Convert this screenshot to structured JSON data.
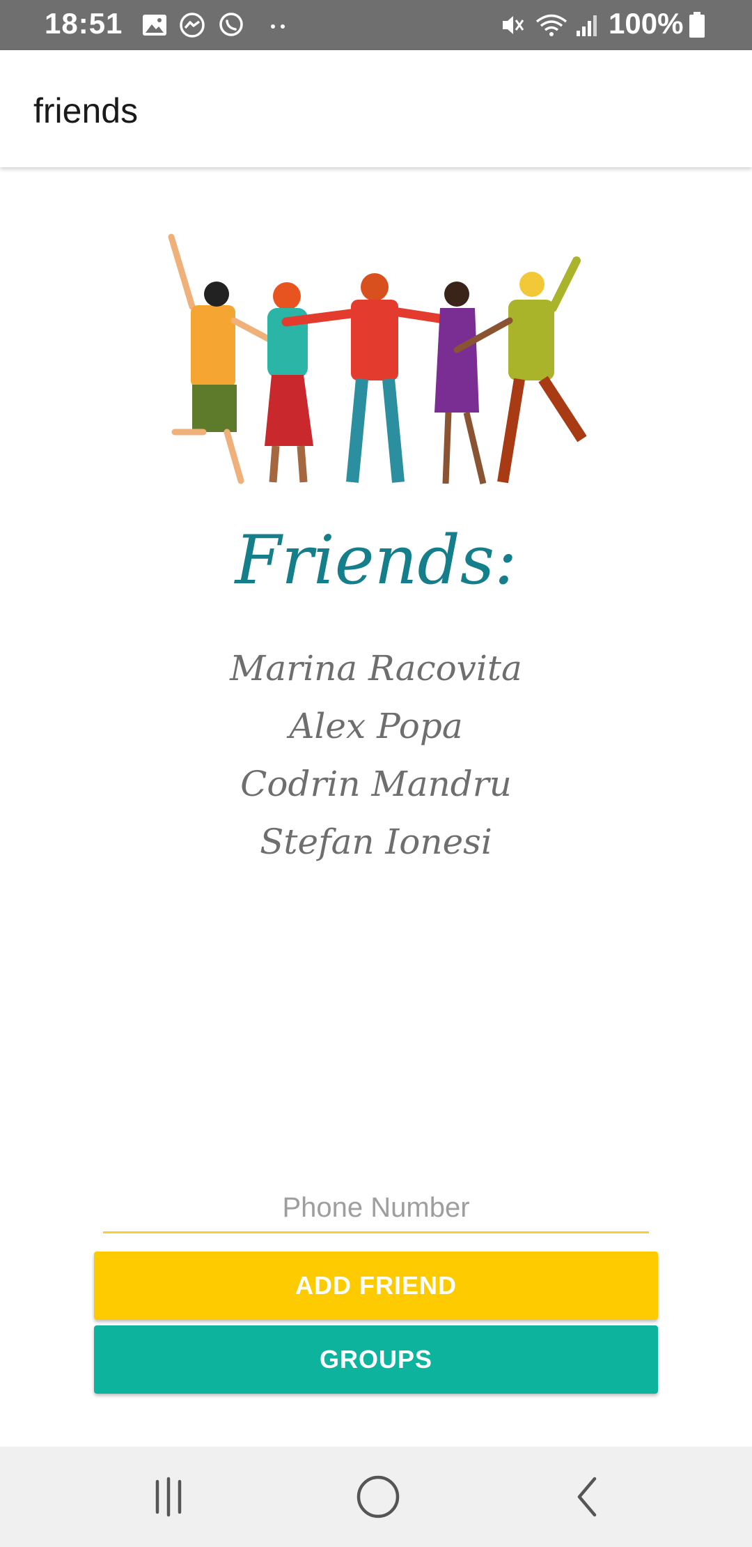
{
  "status_bar": {
    "time": "18:51",
    "battery": "100%",
    "icons": [
      "gallery-icon",
      "messenger-icon",
      "whatsapp-icon",
      "more-dots-icon",
      "mute-icon",
      "wifi-icon",
      "signal-icon",
      "battery-icon"
    ]
  },
  "app_bar": {
    "title": "friends"
  },
  "main": {
    "heading": "Friends:",
    "friends": [
      "Marina Racovita",
      "Alex Popa",
      "Codrin Mandru",
      "Stefan Ionesi"
    ],
    "phone_placeholder": "Phone Number",
    "phone_value": ""
  },
  "buttons": {
    "add_friend": "ADD FRIEND",
    "groups": "GROUPS"
  },
  "colors": {
    "status_bar": "#6f6f6f",
    "heading": "#157e8b",
    "add_button": "#fecb00",
    "groups_button": "#0db39d",
    "input_underline": "#f4cf3b"
  },
  "nav_bar": {
    "icons": [
      "recent-apps-icon",
      "home-icon",
      "back-icon"
    ]
  }
}
